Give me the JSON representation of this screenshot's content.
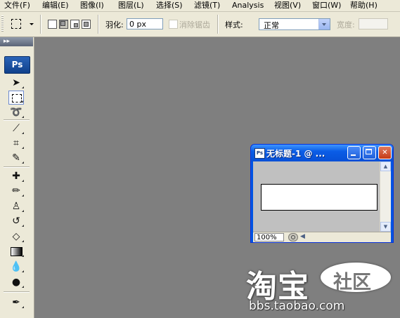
{
  "menubar": {
    "items": [
      "文件(F)",
      "编辑(E)",
      "图像(I)",
      "图层(L)",
      "选择(S)",
      "滤镜(T)",
      "Analysis",
      "视图(V)",
      "窗口(W)",
      "帮助(H)"
    ]
  },
  "options": {
    "feather_label": "羽化:",
    "feather_value": "0 px",
    "antialias_label": "消除锯齿",
    "antialias_checked": false,
    "style_label": "样式:",
    "style_value": "正常",
    "width_label": "宽度:",
    "width_value": ""
  },
  "toolbox": {
    "header": "▸▸",
    "logo": "Ps",
    "tools": [
      "move-tool",
      "rectangular-marquee-tool",
      "lasso-tool",
      "magic-wand-tool",
      "crop-tool",
      "slice-tool",
      "healing-brush-tool",
      "brush-tool",
      "clone-stamp-tool",
      "history-brush-tool",
      "eraser-tool",
      "gradient-tool",
      "blur-tool",
      "dodge-tool",
      "pen-tool"
    ],
    "selected_tool": "rectangular-marquee-tool"
  },
  "document": {
    "icon": "Ps",
    "title": "无标题-1 @ ...",
    "zoom": "100%"
  },
  "watermark": {
    "main": "淘宝",
    "bubble": "社区",
    "url": "bbs.taobao.com"
  }
}
